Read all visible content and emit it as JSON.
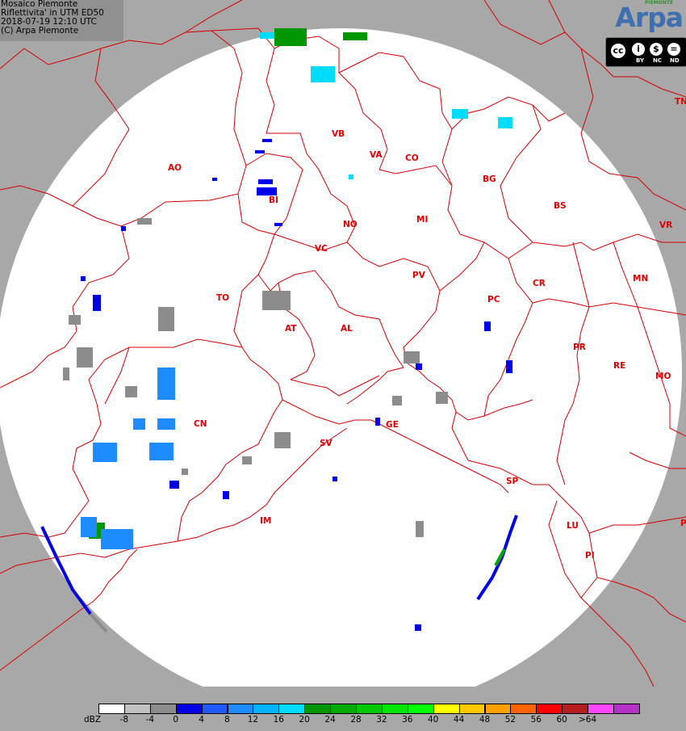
{
  "header": {
    "line1": "Mosaico Piemonte",
    "line2": "Riflettivita' in UTM ED50",
    "line3": "2018-07-19 12:10 UTC",
    "line4": "(C) Arpa Piemonte"
  },
  "logo": {
    "text": "Arpa",
    "subtext": "PIEMONTE"
  },
  "license": {
    "by": "BY",
    "nc": "NC",
    "nd": "ND"
  },
  "colors": {
    "outside_radar": "#a8a8a8",
    "inside_radar": "#ffffff",
    "border": "#d40000",
    "province_label": "#e00000"
  },
  "provinces": [
    {
      "id": "AO",
      "label": "AO"
    },
    {
      "id": "VB",
      "label": "VB"
    },
    {
      "id": "VA",
      "label": "VA"
    },
    {
      "id": "CO",
      "label": "CO"
    },
    {
      "id": "BG",
      "label": "BG"
    },
    {
      "id": "BS",
      "label": "BS"
    },
    {
      "id": "TN",
      "label": "TN"
    },
    {
      "id": "VR",
      "label": "VR"
    },
    {
      "id": "MN",
      "label": "MN"
    },
    {
      "id": "BI",
      "label": "BI"
    },
    {
      "id": "NO",
      "label": "NO"
    },
    {
      "id": "MI",
      "label": "MI"
    },
    {
      "id": "VC",
      "label": "VC"
    },
    {
      "id": "PV",
      "label": "PV"
    },
    {
      "id": "PC",
      "label": "PC"
    },
    {
      "id": "CR",
      "label": "CR"
    },
    {
      "id": "TO",
      "label": "TO"
    },
    {
      "id": "AT",
      "label": "AT"
    },
    {
      "id": "AL",
      "label": "AL"
    },
    {
      "id": "PR",
      "label": "PR"
    },
    {
      "id": "RE",
      "label": "RE"
    },
    {
      "id": "MO",
      "label": "MO"
    },
    {
      "id": "CN",
      "label": "CN"
    },
    {
      "id": "GE",
      "label": "GE"
    },
    {
      "id": "SV",
      "label": "SV"
    },
    {
      "id": "SP",
      "label": "SP"
    },
    {
      "id": "IM",
      "label": "IM"
    },
    {
      "id": "LU",
      "label": "LU"
    },
    {
      "id": "PI",
      "label": "PI"
    },
    {
      "id": "P",
      "label": "P"
    }
  ],
  "legend": {
    "unit": "dBZ",
    "classes": [
      {
        "color": "#ffffff",
        "label": "-8"
      },
      {
        "color": "#c0c0c0",
        "label": "-4"
      },
      {
        "color": "#8c8c8c",
        "label": "0"
      },
      {
        "color": "#0000e6",
        "label": "4"
      },
      {
        "color": "#1e5aff",
        "label": "8"
      },
      {
        "color": "#1e8cff",
        "label": "12"
      },
      {
        "color": "#00b4ff",
        "label": "16"
      },
      {
        "color": "#00dcff",
        "label": "20"
      },
      {
        "color": "#009600",
        "label": "24"
      },
      {
        "color": "#00aa00",
        "label": "28"
      },
      {
        "color": "#00c800",
        "label": "32"
      },
      {
        "color": "#00e600",
        "label": "36"
      },
      {
        "color": "#00ff00",
        "label": "40"
      },
      {
        "color": "#ffff00",
        "label": "44"
      },
      {
        "color": "#ffc800",
        "label": "48"
      },
      {
        "color": "#ffa000",
        "label": "52"
      },
      {
        "color": "#ff6400",
        "label": "56"
      },
      {
        "color": "#ff0000",
        "label": "60"
      },
      {
        "color": "#b41e1e",
        "label": ">64"
      },
      {
        "color": "#ff46ff",
        "label": ""
      },
      {
        "color": "#b432c8",
        "label": ""
      }
    ]
  }
}
